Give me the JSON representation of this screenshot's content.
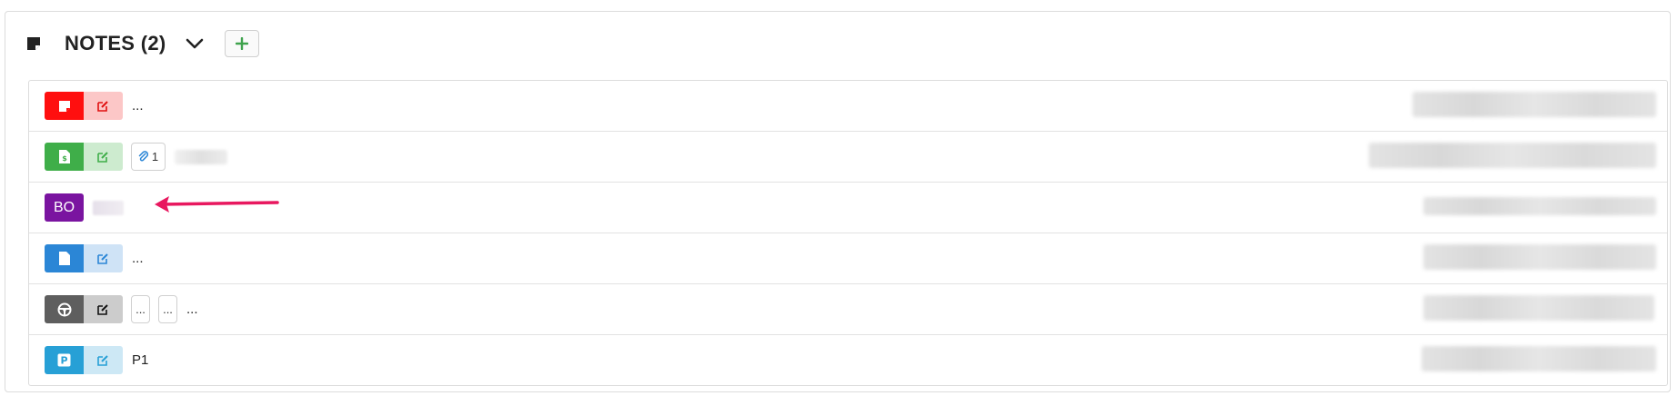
{
  "header": {
    "title": "NOTES (2)"
  },
  "colors": {
    "red": "#ff0f0f",
    "red_light": "#fcc7c7",
    "green": "#3fae49",
    "green_light": "#cdebcf",
    "purple": "#7a14a0",
    "blue": "#2b86d6",
    "blue_light": "#cfe3f6",
    "gray": "#5e5e5e",
    "gray_light": "#cccccc",
    "teal": "#27a0d6",
    "teal_light": "#cde8f5",
    "annotation_arrow": "#e8185f"
  },
  "rows": [
    {
      "type_icon": "sticky-note-icon",
      "edit_icon": "edit-icon",
      "text": "..."
    },
    {
      "type_icon": "invoice-icon",
      "edit_icon": "edit-icon",
      "attachment_count": "1"
    },
    {
      "badge": "BO"
    },
    {
      "type_icon": "document-icon",
      "edit_icon": "edit-icon",
      "text": "..."
    },
    {
      "type_icon": "steering-wheel-icon",
      "edit_icon": "edit-icon",
      "chip1": "...",
      "chip2": "...",
      "text": "..."
    },
    {
      "type_icon": "parking-icon",
      "edit_icon": "edit-icon",
      "text": "P1"
    }
  ]
}
